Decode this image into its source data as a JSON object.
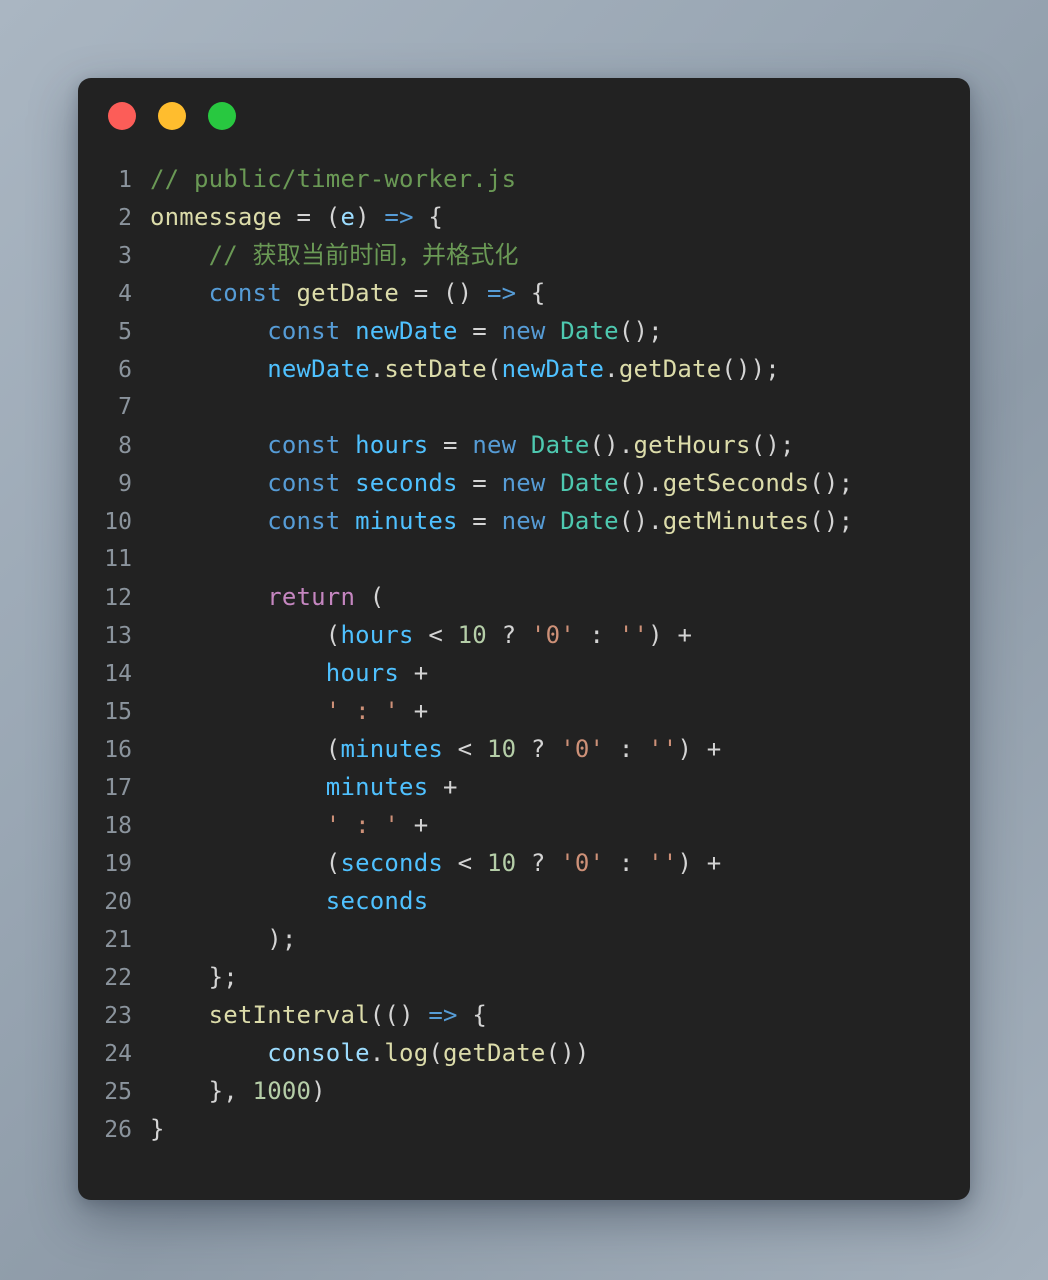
{
  "window": {
    "background_color": "#222222",
    "corner_radius_px": 13,
    "traffic_lights": [
      {
        "name": "close",
        "color": "#fc5d58"
      },
      {
        "name": "minimize",
        "color": "#ffbd2e"
      },
      {
        "name": "maximize",
        "color": "#28c840"
      }
    ]
  },
  "page": {
    "background_colors": [
      "#aab6c2",
      "#9aa7b4",
      "#8e9ba8",
      "#a4b0bc"
    ]
  },
  "editor": {
    "language": "javascript",
    "total_lines": 26,
    "theme_colors": {
      "comment": "#6a9955",
      "keyword": "#569cd6",
      "control": "#c586c0",
      "function": "#dcdcaa",
      "variable": "#9cdcfe",
      "variable_bright": "#4fc1ff",
      "type": "#4ec9b0",
      "number": "#b5cea8",
      "string": "#ce9178",
      "plain": "#d4d4d4",
      "line_number": "#8b949d"
    },
    "line_numbers": [
      "1",
      "2",
      "3",
      "4",
      "5",
      "6",
      "7",
      "8",
      "9",
      "10",
      "11",
      "12",
      "13",
      "14",
      "15",
      "16",
      "17",
      "18",
      "19",
      "20",
      "21",
      "22",
      "23",
      "24",
      "25",
      "26"
    ],
    "lines": [
      {
        "n": "1",
        "tokens": [
          {
            "t": "// public/timer-worker.js",
            "c": "com"
          }
        ]
      },
      {
        "n": "2",
        "tokens": [
          {
            "t": "onmessage",
            "c": "fn"
          },
          {
            "t": " = ",
            "c": "pln"
          },
          {
            "t": "(",
            "c": "pln"
          },
          {
            "t": "e",
            "c": "var"
          },
          {
            "t": ") ",
            "c": "pln"
          },
          {
            "t": "=>",
            "c": "key"
          },
          {
            "t": " {",
            "c": "pln"
          }
        ]
      },
      {
        "n": "3",
        "tokens": [
          {
            "t": "    // 获取当前时间，并格式化",
            "c": "com"
          }
        ]
      },
      {
        "n": "4",
        "tokens": [
          {
            "t": "    ",
            "c": "pln"
          },
          {
            "t": "const",
            "c": "key"
          },
          {
            "t": " ",
            "c": "pln"
          },
          {
            "t": "getDate",
            "c": "fn"
          },
          {
            "t": " = () ",
            "c": "pln"
          },
          {
            "t": "=>",
            "c": "key"
          },
          {
            "t": " {",
            "c": "pln"
          }
        ]
      },
      {
        "n": "5",
        "tokens": [
          {
            "t": "        ",
            "c": "pln"
          },
          {
            "t": "const",
            "c": "key"
          },
          {
            "t": " ",
            "c": "pln"
          },
          {
            "t": "newDate",
            "c": "var2"
          },
          {
            "t": " = ",
            "c": "pln"
          },
          {
            "t": "new",
            "c": "key"
          },
          {
            "t": " ",
            "c": "pln"
          },
          {
            "t": "Date",
            "c": "type"
          },
          {
            "t": "();",
            "c": "pln"
          }
        ]
      },
      {
        "n": "6",
        "tokens": [
          {
            "t": "        ",
            "c": "pln"
          },
          {
            "t": "newDate",
            "c": "var2"
          },
          {
            "t": ".",
            "c": "pln"
          },
          {
            "t": "setDate",
            "c": "fn"
          },
          {
            "t": "(",
            "c": "pln"
          },
          {
            "t": "newDate",
            "c": "var2"
          },
          {
            "t": ".",
            "c": "pln"
          },
          {
            "t": "getDate",
            "c": "fn"
          },
          {
            "t": "());",
            "c": "pln"
          }
        ]
      },
      {
        "n": "7",
        "tokens": [
          {
            "t": "",
            "c": "pln"
          }
        ]
      },
      {
        "n": "8",
        "tokens": [
          {
            "t": "        ",
            "c": "pln"
          },
          {
            "t": "const",
            "c": "key"
          },
          {
            "t": " ",
            "c": "pln"
          },
          {
            "t": "hours",
            "c": "var2"
          },
          {
            "t": " = ",
            "c": "pln"
          },
          {
            "t": "new",
            "c": "key"
          },
          {
            "t": " ",
            "c": "pln"
          },
          {
            "t": "Date",
            "c": "type"
          },
          {
            "t": "().",
            "c": "pln"
          },
          {
            "t": "getHours",
            "c": "fn"
          },
          {
            "t": "();",
            "c": "pln"
          }
        ]
      },
      {
        "n": "9",
        "tokens": [
          {
            "t": "        ",
            "c": "pln"
          },
          {
            "t": "const",
            "c": "key"
          },
          {
            "t": " ",
            "c": "pln"
          },
          {
            "t": "seconds",
            "c": "var2"
          },
          {
            "t": " = ",
            "c": "pln"
          },
          {
            "t": "new",
            "c": "key"
          },
          {
            "t": " ",
            "c": "pln"
          },
          {
            "t": "Date",
            "c": "type"
          },
          {
            "t": "().",
            "c": "pln"
          },
          {
            "t": "getSeconds",
            "c": "fn"
          },
          {
            "t": "();",
            "c": "pln"
          }
        ]
      },
      {
        "n": "10",
        "tokens": [
          {
            "t": "        ",
            "c": "pln"
          },
          {
            "t": "const",
            "c": "key"
          },
          {
            "t": " ",
            "c": "pln"
          },
          {
            "t": "minutes",
            "c": "var2"
          },
          {
            "t": " = ",
            "c": "pln"
          },
          {
            "t": "new",
            "c": "key"
          },
          {
            "t": " ",
            "c": "pln"
          },
          {
            "t": "Date",
            "c": "type"
          },
          {
            "t": "().",
            "c": "pln"
          },
          {
            "t": "getMinutes",
            "c": "fn"
          },
          {
            "t": "();",
            "c": "pln"
          }
        ]
      },
      {
        "n": "11",
        "tokens": [
          {
            "t": "",
            "c": "pln"
          }
        ]
      },
      {
        "n": "12",
        "tokens": [
          {
            "t": "        ",
            "c": "pln"
          },
          {
            "t": "return",
            "c": "ctl"
          },
          {
            "t": " (",
            "c": "pln"
          }
        ]
      },
      {
        "n": "13",
        "tokens": [
          {
            "t": "            (",
            "c": "pln"
          },
          {
            "t": "hours",
            "c": "var2"
          },
          {
            "t": " < ",
            "c": "pln"
          },
          {
            "t": "10",
            "c": "num"
          },
          {
            "t": " ? ",
            "c": "pln"
          },
          {
            "t": "'0'",
            "c": "str"
          },
          {
            "t": " : ",
            "c": "pln"
          },
          {
            "t": "''",
            "c": "str"
          },
          {
            "t": ") +",
            "c": "pln"
          }
        ]
      },
      {
        "n": "14",
        "tokens": [
          {
            "t": "            ",
            "c": "pln"
          },
          {
            "t": "hours",
            "c": "var2"
          },
          {
            "t": " +",
            "c": "pln"
          }
        ]
      },
      {
        "n": "15",
        "tokens": [
          {
            "t": "            ",
            "c": "pln"
          },
          {
            "t": "' : '",
            "c": "str"
          },
          {
            "t": " +",
            "c": "pln"
          }
        ]
      },
      {
        "n": "16",
        "tokens": [
          {
            "t": "            (",
            "c": "pln"
          },
          {
            "t": "minutes",
            "c": "var2"
          },
          {
            "t": " < ",
            "c": "pln"
          },
          {
            "t": "10",
            "c": "num"
          },
          {
            "t": " ? ",
            "c": "pln"
          },
          {
            "t": "'0'",
            "c": "str"
          },
          {
            "t": " : ",
            "c": "pln"
          },
          {
            "t": "''",
            "c": "str"
          },
          {
            "t": ") +",
            "c": "pln"
          }
        ]
      },
      {
        "n": "17",
        "tokens": [
          {
            "t": "            ",
            "c": "pln"
          },
          {
            "t": "minutes",
            "c": "var2"
          },
          {
            "t": " +",
            "c": "pln"
          }
        ]
      },
      {
        "n": "18",
        "tokens": [
          {
            "t": "            ",
            "c": "pln"
          },
          {
            "t": "' : '",
            "c": "str"
          },
          {
            "t": " +",
            "c": "pln"
          }
        ]
      },
      {
        "n": "19",
        "tokens": [
          {
            "t": "            (",
            "c": "pln"
          },
          {
            "t": "seconds",
            "c": "var2"
          },
          {
            "t": " < ",
            "c": "pln"
          },
          {
            "t": "10",
            "c": "num"
          },
          {
            "t": " ? ",
            "c": "pln"
          },
          {
            "t": "'0'",
            "c": "str"
          },
          {
            "t": " : ",
            "c": "pln"
          },
          {
            "t": "''",
            "c": "str"
          },
          {
            "t": ") +",
            "c": "pln"
          }
        ]
      },
      {
        "n": "20",
        "tokens": [
          {
            "t": "            ",
            "c": "pln"
          },
          {
            "t": "seconds",
            "c": "var2"
          }
        ]
      },
      {
        "n": "21",
        "tokens": [
          {
            "t": "        );",
            "c": "pln"
          }
        ]
      },
      {
        "n": "22",
        "tokens": [
          {
            "t": "    };",
            "c": "pln"
          }
        ]
      },
      {
        "n": "23",
        "tokens": [
          {
            "t": "    ",
            "c": "pln"
          },
          {
            "t": "setInterval",
            "c": "fn"
          },
          {
            "t": "(() ",
            "c": "pln"
          },
          {
            "t": "=>",
            "c": "key"
          },
          {
            "t": " {",
            "c": "pln"
          }
        ]
      },
      {
        "n": "24",
        "tokens": [
          {
            "t": "        ",
            "c": "pln"
          },
          {
            "t": "console",
            "c": "var"
          },
          {
            "t": ".",
            "c": "pln"
          },
          {
            "t": "log",
            "c": "fn"
          },
          {
            "t": "(",
            "c": "pln"
          },
          {
            "t": "getDate",
            "c": "fn"
          },
          {
            "t": "())",
            "c": "pln"
          }
        ]
      },
      {
        "n": "25",
        "tokens": [
          {
            "t": "    }, ",
            "c": "pln"
          },
          {
            "t": "1000",
            "c": "num"
          },
          {
            "t": ")",
            "c": "pln"
          }
        ]
      },
      {
        "n": "26",
        "tokens": [
          {
            "t": "}",
            "c": "pln"
          }
        ]
      }
    ]
  }
}
